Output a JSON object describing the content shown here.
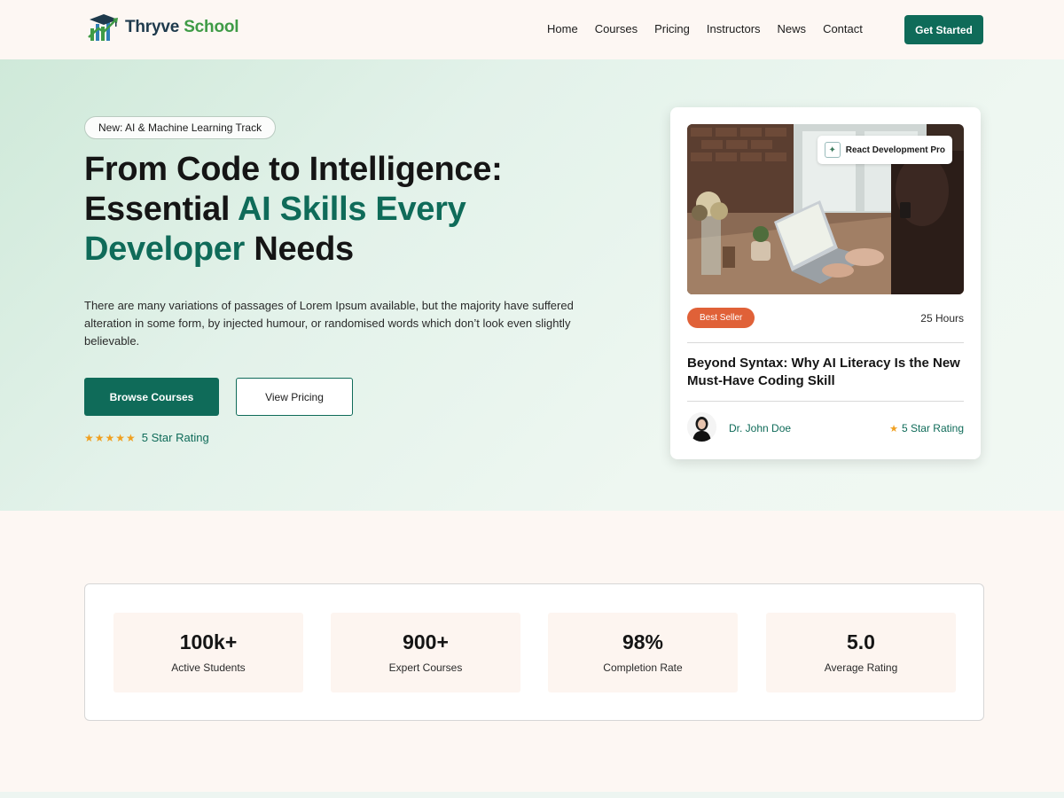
{
  "brand": {
    "part1": "Thryve",
    "part2": "School"
  },
  "nav": {
    "items": [
      "Home",
      "Courses",
      "Pricing",
      "Instructors",
      "News",
      "Contact"
    ],
    "cta": "Get Started"
  },
  "hero": {
    "pill": "New: AI & Machine Learning Track",
    "headline": {
      "line1": "From Code to Intelligence:",
      "line2_a": "Essential ",
      "line2_b": "AI Skills Every",
      "line3_a": "Developer",
      "line3_b": " Needs"
    },
    "lead": "There are many variations of passages of Lorem Ipsum available, but the majority have suffered alteration in some form, by injected humour, or randomised words which don’t look even slightly believable.",
    "primary_button": "Browse Courses",
    "secondary_button": "View Pricing",
    "rating_stars": "★★★★★",
    "rating_text": "5 Star Rating"
  },
  "course_card": {
    "tag": "React Development Pro",
    "badge": "Best Seller",
    "hours": "25 Hours",
    "title": "Beyond Syntax: Why AI Literacy Is the New Must-Have Coding Skill",
    "author": "Dr. John Doe",
    "rating_star": "★",
    "rating_text": "5 Star Rating"
  },
  "stats": [
    {
      "value": "100k+",
      "label": "Active Students"
    },
    {
      "value": "900+",
      "label": "Expert Courses"
    },
    {
      "value": "98%",
      "label": "Completion Rate"
    },
    {
      "value": "5.0",
      "label": "Average Rating"
    }
  ],
  "colors": {
    "primary": "#0f6b59",
    "accent_orange": "#e06138",
    "star": "#f0a020",
    "page_bg": "#fdf7f3"
  }
}
